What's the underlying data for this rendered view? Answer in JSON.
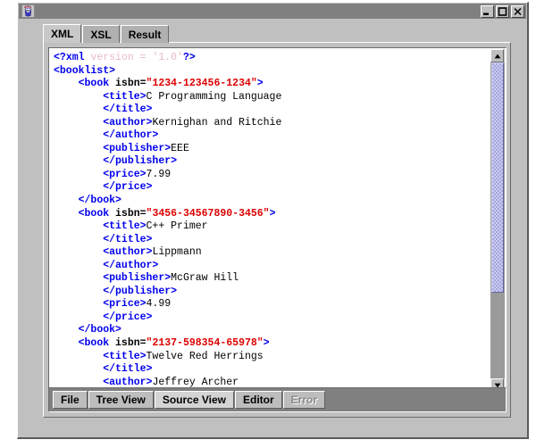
{
  "window": {
    "title": "",
    "icon_name": "java-duke-icon",
    "controls": [
      {
        "name": "minimize-button",
        "glyph": "minimize"
      },
      {
        "name": "maximize-button",
        "glyph": "maximize"
      },
      {
        "name": "close-button",
        "glyph": "close"
      }
    ]
  },
  "tabs": {
    "selected": "XML",
    "items": [
      {
        "label": "XML"
      },
      {
        "label": "XSL"
      },
      {
        "label": "Result"
      }
    ]
  },
  "editor": {
    "language": "xml",
    "lines": [
      [
        {
          "t": "<?",
          "c": "tok-decl"
        },
        {
          "t": "xml",
          "c": "tok-decl"
        },
        {
          "t": " version = '1.0'",
          "c": "tok-declattr"
        },
        {
          "t": "?>",
          "c": "tok-decl"
        }
      ],
      [
        {
          "t": "<booklist>",
          "c": "tok-tag"
        }
      ],
      [
        {
          "t": "    ",
          "c": "tok-text"
        },
        {
          "t": "<book ",
          "c": "tok-tag"
        },
        {
          "t": "isbn",
          "c": "tok-attr"
        },
        {
          "t": "=",
          "c": "tok-attr"
        },
        {
          "t": "\"1234-123456-1234\"",
          "c": "tok-string"
        },
        {
          "t": ">",
          "c": "tok-tag"
        }
      ],
      [
        {
          "t": "        ",
          "c": "tok-text"
        },
        {
          "t": "<title>",
          "c": "tok-tag"
        },
        {
          "t": "C Programming Language",
          "c": "tok-text"
        }
      ],
      [
        {
          "t": "        ",
          "c": "tok-text"
        },
        {
          "t": "</title>",
          "c": "tok-tag"
        }
      ],
      [
        {
          "t": "        ",
          "c": "tok-text"
        },
        {
          "t": "<author>",
          "c": "tok-tag"
        },
        {
          "t": "Kernighan and Ritchie",
          "c": "tok-text"
        }
      ],
      [
        {
          "t": "        ",
          "c": "tok-text"
        },
        {
          "t": "</author>",
          "c": "tok-tag"
        }
      ],
      [
        {
          "t": "        ",
          "c": "tok-text"
        },
        {
          "t": "<publisher>",
          "c": "tok-tag"
        },
        {
          "t": "EEE",
          "c": "tok-text"
        }
      ],
      [
        {
          "t": "        ",
          "c": "tok-text"
        },
        {
          "t": "</publisher>",
          "c": "tok-tag"
        }
      ],
      [
        {
          "t": "        ",
          "c": "tok-text"
        },
        {
          "t": "<price>",
          "c": "tok-tag"
        },
        {
          "t": "7.99",
          "c": "tok-text"
        }
      ],
      [
        {
          "t": "        ",
          "c": "tok-text"
        },
        {
          "t": "</price>",
          "c": "tok-tag"
        }
      ],
      [
        {
          "t": "    ",
          "c": "tok-text"
        },
        {
          "t": "</book>",
          "c": "tok-tag"
        }
      ],
      [
        {
          "t": "    ",
          "c": "tok-text"
        },
        {
          "t": "<book ",
          "c": "tok-tag"
        },
        {
          "t": "isbn",
          "c": "tok-attr"
        },
        {
          "t": "=",
          "c": "tok-attr"
        },
        {
          "t": "\"3456-34567890-3456\"",
          "c": "tok-string"
        },
        {
          "t": ">",
          "c": "tok-tag"
        }
      ],
      [
        {
          "t": "        ",
          "c": "tok-text"
        },
        {
          "t": "<title>",
          "c": "tok-tag"
        },
        {
          "t": "C++ Primer",
          "c": "tok-text"
        }
      ],
      [
        {
          "t": "        ",
          "c": "tok-text"
        },
        {
          "t": "</title>",
          "c": "tok-tag"
        }
      ],
      [
        {
          "t": "        ",
          "c": "tok-text"
        },
        {
          "t": "<author>",
          "c": "tok-tag"
        },
        {
          "t": "Lippmann",
          "c": "tok-text"
        }
      ],
      [
        {
          "t": "        ",
          "c": "tok-text"
        },
        {
          "t": "</author>",
          "c": "tok-tag"
        }
      ],
      [
        {
          "t": "        ",
          "c": "tok-text"
        },
        {
          "t": "<publisher>",
          "c": "tok-tag"
        },
        {
          "t": "McGraw Hill",
          "c": "tok-text"
        }
      ],
      [
        {
          "t": "        ",
          "c": "tok-text"
        },
        {
          "t": "</publisher>",
          "c": "tok-tag"
        }
      ],
      [
        {
          "t": "        ",
          "c": "tok-text"
        },
        {
          "t": "<price>",
          "c": "tok-tag"
        },
        {
          "t": "4.99",
          "c": "tok-text"
        }
      ],
      [
        {
          "t": "        ",
          "c": "tok-text"
        },
        {
          "t": "</price>",
          "c": "tok-tag"
        }
      ],
      [
        {
          "t": "    ",
          "c": "tok-text"
        },
        {
          "t": "</book>",
          "c": "tok-tag"
        }
      ],
      [
        {
          "t": "    ",
          "c": "tok-text"
        },
        {
          "t": "<book ",
          "c": "tok-tag"
        },
        {
          "t": "isbn",
          "c": "tok-attr"
        },
        {
          "t": "=",
          "c": "tok-attr"
        },
        {
          "t": "\"2137-598354-65978\"",
          "c": "tok-string"
        },
        {
          "t": ">",
          "c": "tok-tag"
        }
      ],
      [
        {
          "t": "        ",
          "c": "tok-text"
        },
        {
          "t": "<title>",
          "c": "tok-tag"
        },
        {
          "t": "Twelve Red Herrings",
          "c": "tok-text"
        }
      ],
      [
        {
          "t": "        ",
          "c": "tok-text"
        },
        {
          "t": "</title>",
          "c": "tok-tag"
        }
      ],
      [
        {
          "t": "        ",
          "c": "tok-text"
        },
        {
          "t": "<author>",
          "c": "tok-tag"
        },
        {
          "t": "Jeffrey Archer",
          "c": "tok-text"
        }
      ]
    ]
  },
  "scrollbars": {
    "vertical": {
      "name": "vertical-scrollbar",
      "thumb_visible": true
    },
    "horizontal": {
      "name": "horizontal-scrollbar",
      "thumb_visible": false
    }
  },
  "button_bar": {
    "buttons": [
      {
        "label": "File",
        "state": "normal"
      },
      {
        "label": "Tree View",
        "state": "normal"
      },
      {
        "label": "Source View",
        "state": "active"
      },
      {
        "label": "Editor",
        "state": "normal"
      },
      {
        "label": "Error",
        "state": "disabled"
      }
    ]
  },
  "colors": {
    "tag": "#0000ee",
    "string": "#dd0000",
    "text": "#000000",
    "scrollbar_thumb": "#a6a6dd",
    "panel": "#c0c0c0",
    "titlebar": "#808080"
  }
}
